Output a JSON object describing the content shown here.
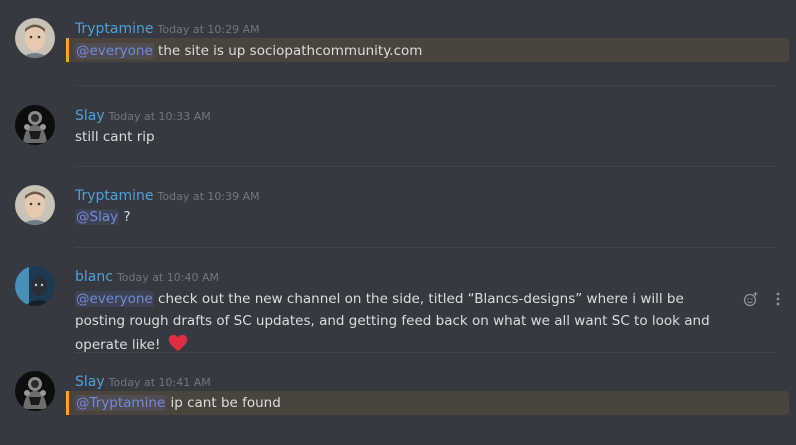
{
  "messages": [
    {
      "username": "Tryptamine",
      "timestamp": "Today at 10:29 AM",
      "mention": "@everyone",
      "text": " the site is up sociopathcommunity.com"
    },
    {
      "username": "Slay",
      "timestamp": "Today at 10:33 AM",
      "text": "still cant rip"
    },
    {
      "username": "Tryptamine",
      "timestamp": "Today at 10:39 AM",
      "mention": "@Slay",
      "text": " ?"
    },
    {
      "username": "blanc",
      "timestamp": "Today at 10:40 AM",
      "mention": "@everyone",
      "text": " check out the new channel on the side, titled “Blancs-designs” where i will be posting rough drafts of SC updates, and getting feed back on what we all want SC to look and operate like! ",
      "emoji": "heart-icon"
    },
    {
      "username": "Slay",
      "timestamp": "Today at 10:41 AM",
      "mention": "@Tryptamine",
      "text": " ip cant be found"
    }
  ],
  "colors": {
    "background": "#36393f",
    "username": "#4f9fd8",
    "mention": "#7289da",
    "highlight_bar": "#faa61a",
    "highlight_bg": "#49443c",
    "heart": "#dd2e44"
  }
}
